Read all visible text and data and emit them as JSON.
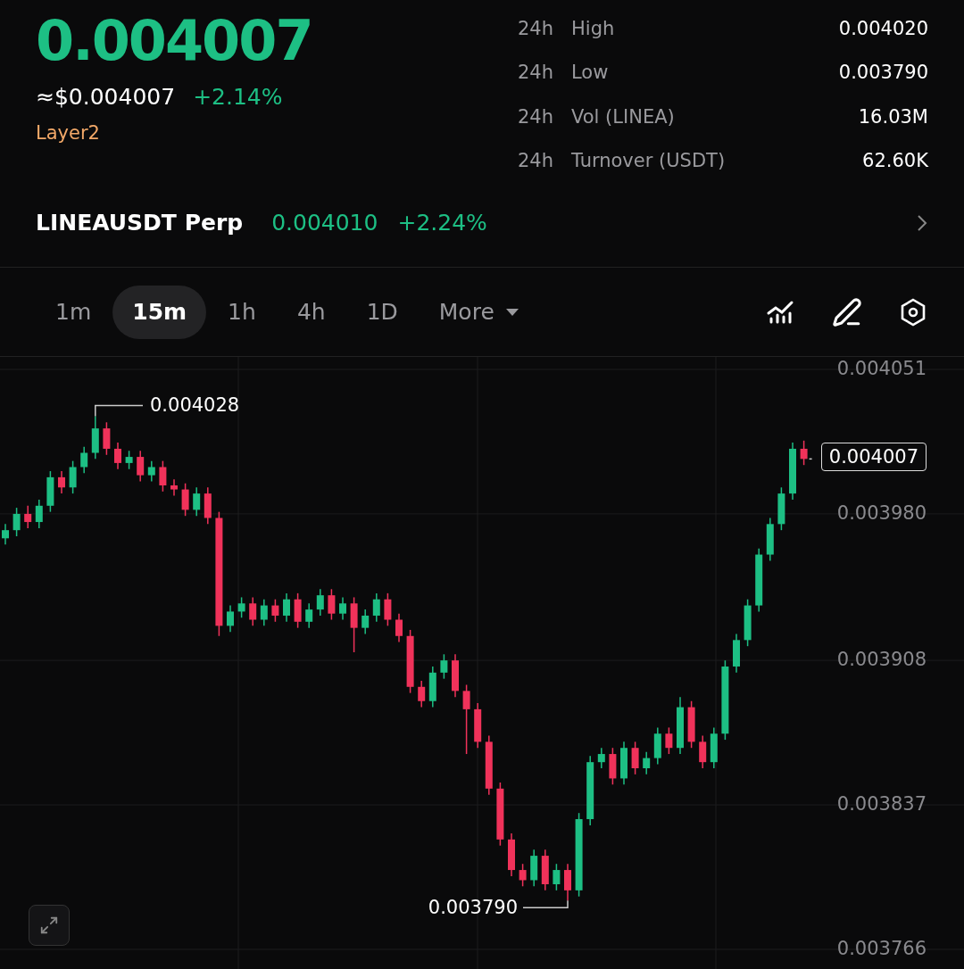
{
  "price": {
    "last": "0.004007",
    "fiat": "≈$0.004007",
    "change": "+2.14%",
    "tag": "Layer2"
  },
  "stats": [
    {
      "period": "24h",
      "label": "High",
      "value": "0.004020"
    },
    {
      "period": "24h",
      "label": "Low",
      "value": "0.003790"
    },
    {
      "period": "24h",
      "label": "Vol (LINEA)",
      "value": "16.03M"
    },
    {
      "period": "24h",
      "label": "Turnover (USDT)",
      "value": "62.60K"
    }
  ],
  "perp": {
    "symbol": "LINEAUSDT Perp",
    "price": "0.004010",
    "change": "+2.24%"
  },
  "intervals": [
    {
      "label": "1m",
      "selected": false,
      "kind": "interval"
    },
    {
      "label": "15m",
      "selected": true,
      "kind": "interval"
    },
    {
      "label": "1h",
      "selected": false,
      "kind": "interval"
    },
    {
      "label": "4h",
      "selected": false,
      "kind": "interval"
    },
    {
      "label": "1D",
      "selected": false,
      "kind": "interval"
    },
    {
      "label": "More",
      "selected": false,
      "kind": "dropdown"
    }
  ],
  "chart": {
    "high_marker": "0.004028",
    "low_marker": "0.003790",
    "current_price": "0.004007",
    "chart_data": {
      "type": "candlestick",
      "grid": true,
      "yticks": [
        {
          "value": 0.004051,
          "label": "0.004051"
        },
        {
          "value": 0.00398,
          "label": "0.003980"
        },
        {
          "value": 0.003908,
          "label": "0.003908"
        },
        {
          "value": 0.003837,
          "label": "0.003837"
        },
        {
          "value": 0.003766,
          "label": "0.003766"
        }
      ],
      "ylim": [
        0.003766,
        0.004051
      ],
      "ohlc": [
        [
          0.003968,
          0.003975,
          0.003965,
          0.003972
        ],
        [
          0.003972,
          0.003983,
          0.003969,
          0.00398
        ],
        [
          0.00398,
          0.003984,
          0.003973,
          0.003976
        ],
        [
          0.003976,
          0.003987,
          0.003973,
          0.003984
        ],
        [
          0.003984,
          0.004001,
          0.003981,
          0.003998
        ],
        [
          0.003998,
          0.004001,
          0.00399,
          0.003993
        ],
        [
          0.003993,
          0.004006,
          0.00399,
          0.004003
        ],
        [
          0.004003,
          0.004013,
          0.004,
          0.00401
        ],
        [
          0.00401,
          0.004028,
          0.004007,
          0.004022
        ],
        [
          0.004022,
          0.004025,
          0.004009,
          0.004012
        ],
        [
          0.004012,
          0.004015,
          0.004002,
          0.004005
        ],
        [
          0.004005,
          0.004011,
          0.004002,
          0.004008
        ],
        [
          0.004008,
          0.004011,
          0.003996,
          0.003999
        ],
        [
          0.003999,
          0.004006,
          0.003996,
          0.004003
        ],
        [
          0.004003,
          0.004006,
          0.003991,
          0.003994
        ],
        [
          0.003994,
          0.003997,
          0.003989,
          0.003992
        ],
        [
          0.003992,
          0.003995,
          0.003979,
          0.003982
        ],
        [
          0.003982,
          0.003993,
          0.003979,
          0.00399
        ],
        [
          0.00399,
          0.003993,
          0.003975,
          0.003978
        ],
        [
          0.003978,
          0.003981,
          0.00392,
          0.003925
        ],
        [
          0.003925,
          0.003935,
          0.003922,
          0.003932
        ],
        [
          0.003932,
          0.003939,
          0.003929,
          0.003936
        ],
        [
          0.003936,
          0.003939,
          0.003925,
          0.003928
        ],
        [
          0.003928,
          0.003938,
          0.003925,
          0.003935
        ],
        [
          0.003935,
          0.003938,
          0.003927,
          0.00393
        ],
        [
          0.00393,
          0.003941,
          0.003927,
          0.003938
        ],
        [
          0.003938,
          0.003941,
          0.003924,
          0.003927
        ],
        [
          0.003927,
          0.003936,
          0.003924,
          0.003933
        ],
        [
          0.003933,
          0.003943,
          0.00393,
          0.00394
        ],
        [
          0.00394,
          0.003943,
          0.003928,
          0.003931
        ],
        [
          0.003931,
          0.003939,
          0.003928,
          0.003936
        ],
        [
          0.003936,
          0.003939,
          0.003912,
          0.003924
        ],
        [
          0.003924,
          0.003933,
          0.003921,
          0.00393
        ],
        [
          0.00393,
          0.003941,
          0.003927,
          0.003938
        ],
        [
          0.003938,
          0.003941,
          0.003925,
          0.003928
        ],
        [
          0.003928,
          0.003931,
          0.003917,
          0.00392
        ],
        [
          0.00392,
          0.003923,
          0.003892,
          0.003895
        ],
        [
          0.003895,
          0.003898,
          0.003885,
          0.003888
        ],
        [
          0.003888,
          0.003905,
          0.003885,
          0.003902
        ],
        [
          0.003902,
          0.003911,
          0.003899,
          0.003908
        ],
        [
          0.003908,
          0.003911,
          0.00389,
          0.003893
        ],
        [
          0.003893,
          0.003896,
          0.003862,
          0.003884
        ],
        [
          0.003884,
          0.003887,
          0.003865,
          0.003868
        ],
        [
          0.003868,
          0.003871,
          0.003842,
          0.003845
        ],
        [
          0.003845,
          0.003848,
          0.003817,
          0.00382
        ],
        [
          0.00382,
          0.003823,
          0.003802,
          0.003805
        ],
        [
          0.003805,
          0.003808,
          0.003797,
          0.0038
        ],
        [
          0.0038,
          0.003815,
          0.003797,
          0.003812
        ],
        [
          0.003812,
          0.003815,
          0.003795,
          0.003798
        ],
        [
          0.003798,
          0.003808,
          0.003795,
          0.003805
        ],
        [
          0.003805,
          0.003808,
          0.00379,
          0.003795
        ],
        [
          0.003795,
          0.003833,
          0.003792,
          0.00383
        ],
        [
          0.00383,
          0.003861,
          0.003827,
          0.003858
        ],
        [
          0.003858,
          0.003865,
          0.003855,
          0.003862
        ],
        [
          0.003862,
          0.003865,
          0.003847,
          0.00385
        ],
        [
          0.00385,
          0.003868,
          0.003847,
          0.003865
        ],
        [
          0.003865,
          0.003868,
          0.003852,
          0.003855
        ],
        [
          0.003855,
          0.003863,
          0.003852,
          0.00386
        ],
        [
          0.00386,
          0.003875,
          0.003857,
          0.003872
        ],
        [
          0.003872,
          0.003875,
          0.003862,
          0.003865
        ],
        [
          0.003865,
          0.00389,
          0.003862,
          0.003885
        ],
        [
          0.003885,
          0.003888,
          0.003865,
          0.003868
        ],
        [
          0.003868,
          0.003871,
          0.003855,
          0.003858
        ],
        [
          0.003858,
          0.003875,
          0.003855,
          0.003872
        ],
        [
          0.003872,
          0.003908,
          0.003869,
          0.003905
        ],
        [
          0.003905,
          0.003921,
          0.003902,
          0.003918
        ],
        [
          0.003918,
          0.003938,
          0.003915,
          0.003935
        ],
        [
          0.003935,
          0.003963,
          0.003932,
          0.00396
        ],
        [
          0.00396,
          0.003978,
          0.003957,
          0.003975
        ],
        [
          0.003975,
          0.003993,
          0.003972,
          0.00399
        ],
        [
          0.00399,
          0.004015,
          0.003987,
          0.004012
        ],
        [
          0.004012,
          0.004016,
          0.004004,
          0.004007
        ]
      ]
    }
  }
}
